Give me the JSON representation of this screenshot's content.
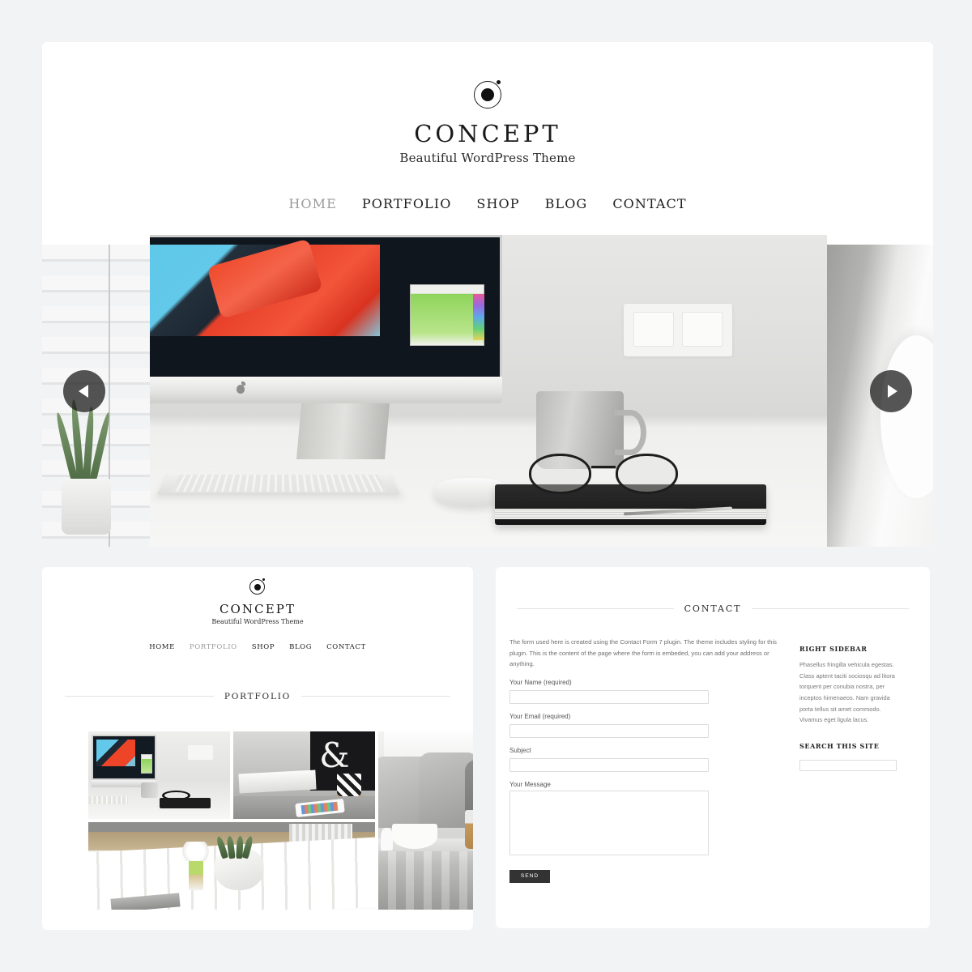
{
  "site": {
    "title": "CONCEPT",
    "tagline": "Beautiful WordPress Theme",
    "logo_icon": "concept-orbit-logo-icon"
  },
  "nav": {
    "items": [
      {
        "label": "HOME",
        "active": true
      },
      {
        "label": "PORTFOLIO",
        "active": false
      },
      {
        "label": "SHOP",
        "active": false
      },
      {
        "label": "BLOG",
        "active": false
      },
      {
        "label": "CONTACT",
        "active": false
      }
    ]
  },
  "slider": {
    "prev_icon": "chevron-left-icon",
    "next_icon": "chevron-right-icon",
    "slides": [
      {
        "alt": "window-blinds-with-plant"
      },
      {
        "alt": "imac-desk-with-mug-glasses-keyboard"
      },
      {
        "alt": "white-plates-closeup"
      }
    ]
  },
  "preview_left": {
    "site": {
      "title": "CONCEPT",
      "tagline": "Beautiful WordPress Theme",
      "logo_icon": "concept-orbit-logo-icon"
    },
    "nav": {
      "items": [
        {
          "label": "HOME",
          "active": false
        },
        {
          "label": "PORTFOLIO",
          "active": true
        },
        {
          "label": "SHOP",
          "active": false
        },
        {
          "label": "BLOG",
          "active": false
        },
        {
          "label": "CONTACT",
          "active": false
        }
      ]
    },
    "portfolio": {
      "heading": "PORTFOLIO",
      "items": [
        {
          "alt": "imac-desk-workspace"
        },
        {
          "alt": "ampersand-wall-with-harlequin-mug"
        },
        {
          "alt": "grey-pillows-with-coffee-and-jar"
        },
        {
          "alt": "white-table-with-succulent-and-hyacinth"
        }
      ]
    }
  },
  "contact": {
    "heading": "CONTACT",
    "intro": "The form used here is created using the Contact Form 7 plugin. The theme includes styling for this plugin. This is the content of the page where the form is embeded, you can add your address or anything.",
    "form": {
      "name_label": "Your Name (required)",
      "name_value": "",
      "email_label": "Your Email (required)",
      "email_value": "",
      "subject_label": "Subject",
      "subject_value": "",
      "message_label": "Your Message",
      "message_value": "",
      "send_label": "SEND",
      "send_bg": "#333333"
    },
    "sidebar": {
      "widget_title": "RIGHT SIDEBAR",
      "widget_text": "Phasellus fringilla vehicula egestas. Class aptent taciti sociosqu ad litora torquent per conubia nostra, per inceptos himenaeos. Nam gravida porta tellus sit amet commodo. Vivamus eget ligula lacus.",
      "search_title": "SEARCH THIS SITE",
      "search_value": "",
      "search_placeholder": ""
    }
  },
  "theme": {
    "page_bg": "#f2f3f5",
    "panel_bg": "#ffffff",
    "text_dark": "#1e1e1e",
    "text_muted": "#9a9a9a",
    "rule": "#e2e2e2"
  }
}
